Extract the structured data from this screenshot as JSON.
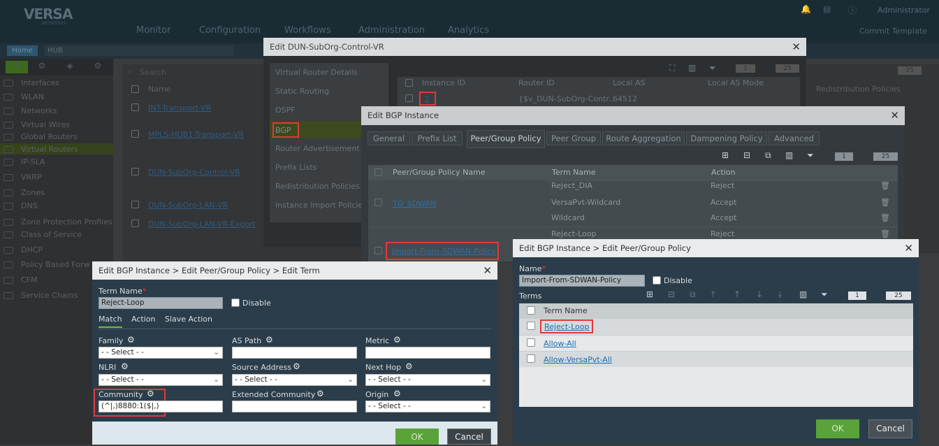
{
  "app": {
    "logo": "VERSA",
    "logo_sub": "NETWORKS",
    "nav": [
      "Monitor",
      "Configuration",
      "Workflows",
      "Administration",
      "Analytics"
    ],
    "user": "Administrator",
    "commit": "Commit Template",
    "home": "Home",
    "org": "HUB"
  },
  "sidebar": {
    "items": [
      "Interfaces",
      "WLAN",
      "Networks",
      "Virtual Wires",
      "Global Routers",
      "Virtual Routers",
      "IP-SLA",
      "VRRP",
      "Zones",
      "DNS",
      "Zone Protection Profiles",
      "Class of Service",
      "DHCP",
      "Policy Based Forw",
      "CFM",
      "Service Chains"
    ]
  },
  "base_list": {
    "search_placeholder": "Search",
    "column": "Name",
    "rows": [
      "INT-Transport-VR",
      "MPLS-HUB1-Transport-VR",
      "DUN-SubOrg-Control-VR",
      "DUN-SubOrg-LAN-VR",
      "DUN-SubOrg-LAN-VR-Export"
    ],
    "right_col": "Redistribution Policies",
    "page_size": "25"
  },
  "dialog_vr": {
    "title": "Edit DUN-SubOrg-Control-VR",
    "nav": [
      "Virtual Router Details",
      "Static Routing",
      "OSPF",
      "BGP",
      "Router Advertisement",
      "Prefix Lists",
      "Redistribution Policies",
      "Instance Import Policies"
    ],
    "columns": [
      "Instance ID",
      "Router ID",
      "Local AS",
      "Local AS Mode"
    ],
    "row": {
      "instance": "2",
      "router_id": "{$v_DUN-SubOrg-Contr...",
      "local_as": "64512"
    },
    "page": "1",
    "page_size": "25"
  },
  "dialog_bgp": {
    "title": "Edit BGP Instance",
    "tabs": [
      "General",
      "Prefix List",
      "Peer/Group Policy",
      "Peer Group",
      "Route Aggregation",
      "Dampening Policy",
      "Advanced"
    ],
    "columns": [
      "Peer/Group Policy Name",
      "Term Name",
      "Action"
    ],
    "policies": [
      {
        "name": "TO_SDWAN",
        "terms": [
          {
            "term": "Reject_DIA",
            "action": "Reject"
          },
          {
            "term": "VersaPvt-Wildcard",
            "action": "Accept"
          },
          {
            "term": "Wildcard",
            "action": "Accept"
          }
        ]
      },
      {
        "name": "Import-From-SDWAN-Policy",
        "terms": [
          {
            "term": "Reject-Loop",
            "action": "Reject"
          }
        ]
      }
    ],
    "page": "1",
    "page_size": "25"
  },
  "dialog_term": {
    "title": "Edit BGP Instance > Edit Peer/Group Policy > Edit Term",
    "term_name_label": "Term Name",
    "term_name": "Reject-Loop",
    "disable": "Disable",
    "tabs": [
      "Match",
      "Action",
      "Slave Action"
    ],
    "fields": {
      "family": {
        "label": "Family",
        "value": "- - Select - -"
      },
      "as_path": {
        "label": "AS Path",
        "value": ""
      },
      "metric": {
        "label": "Metric",
        "value": ""
      },
      "nlri": {
        "label": "NLRI",
        "value": "- - Select - -"
      },
      "source_address": {
        "label": "Source Address",
        "value": "- - Select - -"
      },
      "next_hop": {
        "label": "Next Hop",
        "value": "- - Select - -"
      },
      "community": {
        "label": "Community",
        "value": "(^|,)8880:1($|,)"
      },
      "extended_community": {
        "label": "Extended Community",
        "value": ""
      },
      "origin": {
        "label": "Origin",
        "value": "- - Select - -"
      }
    },
    "ok": "OK",
    "cancel": "Cancel"
  },
  "dialog_policy": {
    "title": "Edit BGP Instance > Edit Peer/Group Policy",
    "name_label": "Name",
    "name": "Import-From-SDWAN-Policy",
    "disable": "Disable",
    "terms_label": "Terms",
    "column": "Term Name",
    "terms": [
      "Reject-Loop",
      "Allow-All",
      "Allow-VersaPvt-All"
    ],
    "page": "1",
    "page_size": "25",
    "ok": "OK",
    "cancel": "Cancel"
  },
  "colors": {
    "highlight": "#e03a3a",
    "ok_green": "#5aa23a",
    "dialog_blue": "#2b3d4a",
    "link": "#1a6fb5"
  }
}
